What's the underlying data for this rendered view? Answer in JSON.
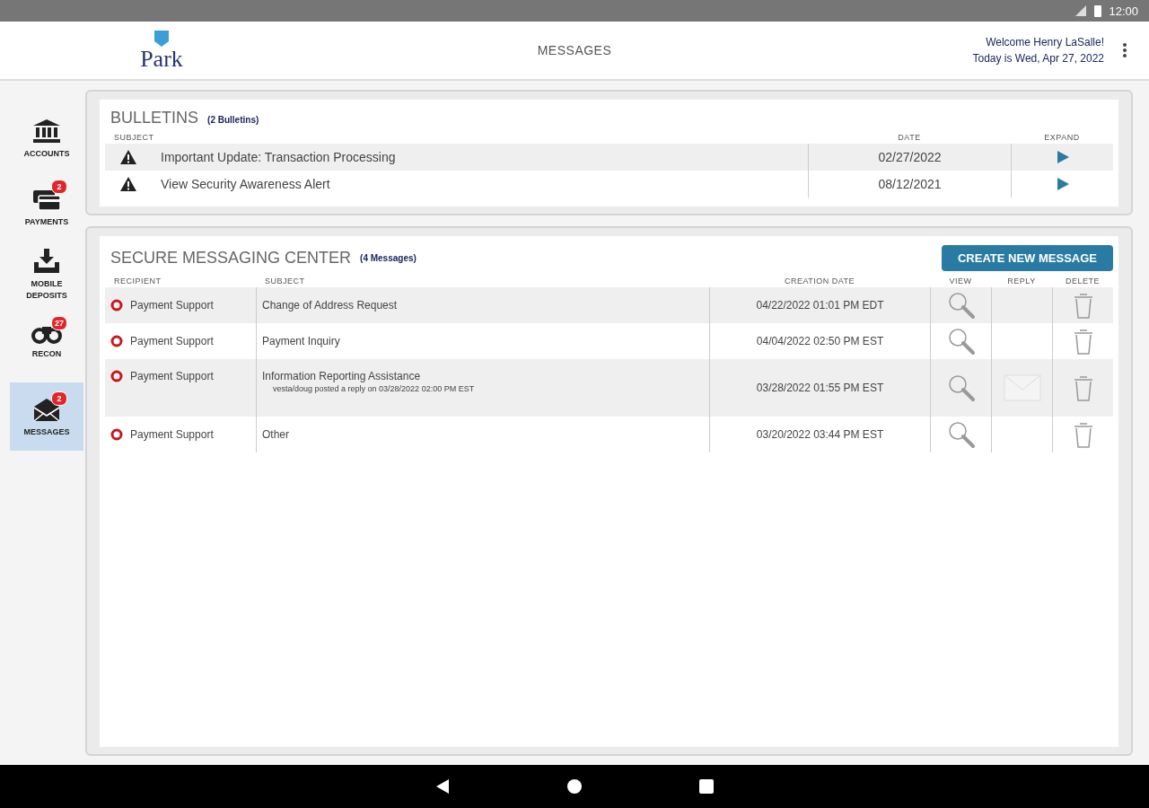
{
  "status_bar": {
    "time": "12:00"
  },
  "header": {
    "logo": "Park",
    "title": "MESSAGES",
    "welcome": "Welcome Henry LaSalle!",
    "today": "Today is Wed, Apr 27, 2022"
  },
  "sidebar": {
    "items": [
      {
        "kind": "bank",
        "label": "ACCOUNTS",
        "selected": false
      },
      {
        "kind": "card",
        "label": "PAYMENTS",
        "badge": "2",
        "selected": false
      },
      {
        "kind": "download",
        "label": "MOBILE DEPOSITS",
        "selected": false
      },
      {
        "kind": "binoculars",
        "label": "RECON",
        "badge": "27",
        "selected": false
      },
      {
        "kind": "mail",
        "label": "MESSAGES",
        "badge": "2",
        "selected": true
      }
    ]
  },
  "bulletins": {
    "title": "BULLETINS",
    "count": "(2 Bulletins)",
    "columns": [
      "SUBJECT",
      "DATE",
      "EXPAND"
    ],
    "rows": [
      {
        "subject": "Important Update: Transaction Processing",
        "date": "02/27/2022"
      },
      {
        "subject": "View Security Awareness Alert",
        "date": "08/12/2021"
      }
    ]
  },
  "messages": {
    "title": "SECURE MESSAGING CENTER",
    "count": "(4 Messages)",
    "create_button": "CREATE NEW MESSAGE",
    "columns": [
      "RECIPIENT",
      "SUBJECT",
      "CREATION DATE",
      "VIEW",
      "REPLY",
      "DELETE"
    ],
    "rows": [
      {
        "recipient": "Payment Support",
        "subject": "Change of Address Request",
        "date": "04/22/2022 01:01 PM EDT",
        "reply": false
      },
      {
        "recipient": "Payment Support",
        "subject": "Payment Inquiry",
        "date": "04/04/2022 02:50 PM EST",
        "reply": false
      },
      {
        "recipient": "Payment Support",
        "subject": "Information Reporting Assistance",
        "note": "vesta/doug posted a reply on 03/28/2022 02:00 PM EST",
        "date": "03/28/2022 01:55 PM EST",
        "reply": true
      },
      {
        "recipient": "Payment Support",
        "subject": "Other",
        "date": "03/20/2022 03:44 PM EST",
        "reply": false
      }
    ]
  }
}
